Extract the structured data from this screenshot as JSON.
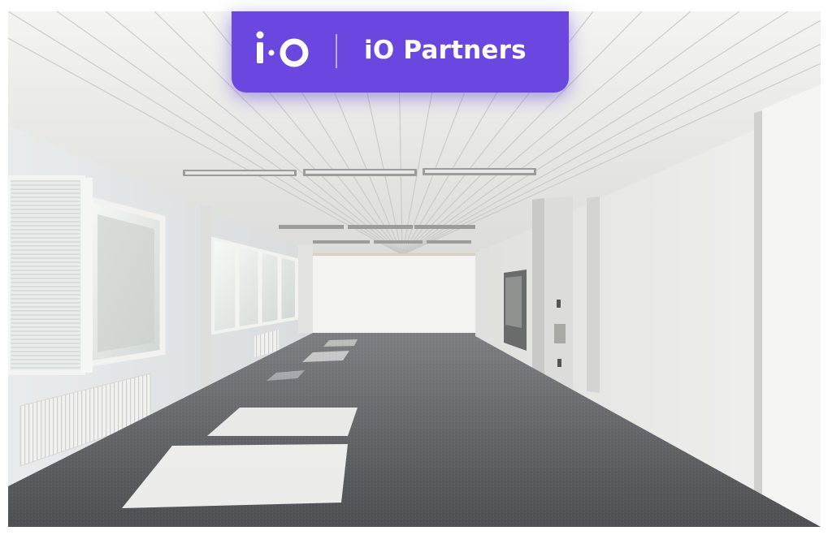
{
  "badge": {
    "logo_mark": "i·O",
    "brand_name": "iO Partners",
    "color": "#6a48e0"
  },
  "photo": {
    "icon": "empty-office-room-photo"
  }
}
